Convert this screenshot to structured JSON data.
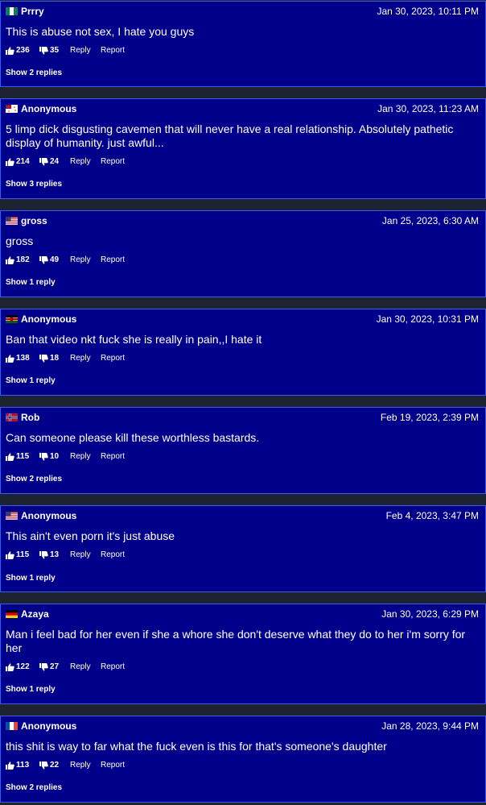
{
  "labels": {
    "reply": "Reply",
    "report": "Report"
  },
  "colors": {
    "card_background": "#00008b",
    "card_border": "#3a5cf0",
    "page_background": "#1d2331",
    "text": "#ffffff"
  },
  "comments": [
    {
      "flag": "nigeria-flag-icon",
      "user": "Prrry",
      "date": "Jan 30, 2023, 10:11 PM",
      "text": "This is abuse not sex, I hate you guys",
      "likes": "236",
      "dislikes": "35",
      "replies": "Show 2 replies"
    },
    {
      "flag": "australia-flag-icon",
      "user": "Anonymous",
      "date": "Jan 30, 2023, 11:23 AM",
      "text": "5 limp dick disgusting cavemen that will never have a real relationship. Absolutely pathetic display of humanity. just awful...",
      "likes": "214",
      "dislikes": "24",
      "replies": "Show 3 replies"
    },
    {
      "flag": "usa-flag-icon",
      "user": "gross",
      "date": "Jan 25, 2023, 6:30 AM",
      "text": "gross",
      "likes": "182",
      "dislikes": "49",
      "replies": "Show 1 reply"
    },
    {
      "flag": "kenya-flag-icon",
      "user": "Anonymous",
      "date": "Jan 30, 2023, 10:31 PM",
      "text": "Ban that video nkt fuck she is really in pain,,I hate it",
      "likes": "138",
      "dislikes": "18",
      "replies": "Show 1 reply"
    },
    {
      "flag": "norway-flag-icon",
      "user": "Rob",
      "date": "Feb 19, 2023, 2:39 PM",
      "text": "Can someone please kill these worthless bastards.",
      "likes": "115",
      "dislikes": "10",
      "replies": "Show 2 replies"
    },
    {
      "flag": "usa-flag-icon",
      "user": "Anonymous",
      "date": "Feb 4, 2023, 3:47 PM",
      "text": "This ain't even porn it's just abuse",
      "likes": "115",
      "dislikes": "13",
      "replies": "Show 1 reply"
    },
    {
      "flag": "germany-flag-icon",
      "user": "Azaya",
      "date": "Jan 30, 2023, 6:29 PM",
      "text": "Man i feel bad for her even if she a whore she don't deserve what they do to her i'm sorry for her",
      "likes": "122",
      "dislikes": "27",
      "replies": "Show 1 reply"
    },
    {
      "flag": "france-flag-icon",
      "user": "Anonymous",
      "date": "Jan 28, 2023, 9:44 PM",
      "text": "this shit is way to far what the fuck even is this for that's someone's daughter",
      "likes": "113",
      "dislikes": "22",
      "replies": "Show 2 replies"
    }
  ]
}
